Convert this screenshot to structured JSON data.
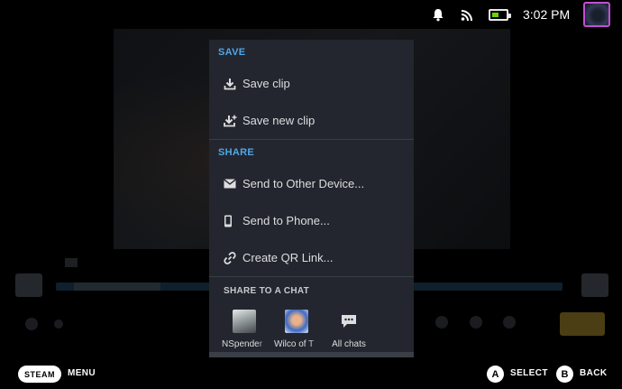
{
  "status_bar": {
    "time": "3:02 PM",
    "icons": [
      "bell-icon",
      "wifi-icon",
      "battery-icon"
    ],
    "battery_color": "#6cd400",
    "avatar_border_color": "#c24fd4"
  },
  "menu": {
    "save": {
      "header": "SAVE",
      "items": [
        {
          "label": "Save clip",
          "icon": "download-icon"
        },
        {
          "label": "Save new clip",
          "icon": "download-new-icon"
        }
      ]
    },
    "share": {
      "header": "SHARE",
      "items": [
        {
          "label": "Send to Other Device...",
          "icon": "envelope-icon"
        },
        {
          "label": "Send to Phone...",
          "icon": "phone-icon"
        },
        {
          "label": "Create QR Link...",
          "icon": "link-icon"
        }
      ]
    },
    "share_to_chat": {
      "header": "SHARE TO A CHAT",
      "chats": [
        {
          "name": "NSpender"
        },
        {
          "name": "Wilco of T"
        },
        {
          "name": "All chats"
        }
      ]
    },
    "accent_color": "#4fa7e8"
  },
  "bottom_bar": {
    "steam_label": "STEAM",
    "menu_label": "MENU",
    "a_glyph": "A",
    "select_label": "SELECT",
    "b_glyph": "B",
    "back_label": "BACK"
  }
}
